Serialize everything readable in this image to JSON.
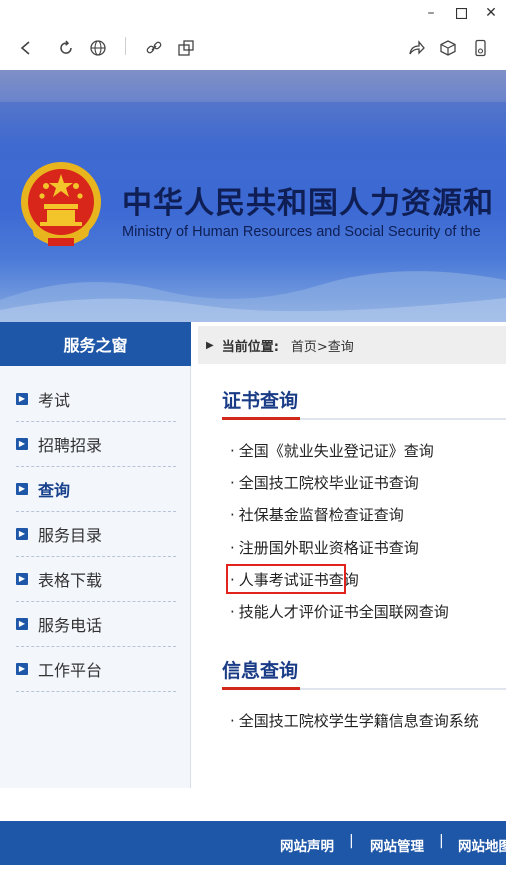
{
  "window": {
    "minimize_label": "–",
    "maximize_label": "☐",
    "close_label": "✕"
  },
  "toolbar": {
    "icons": [
      "back-icon",
      "refresh-icon",
      "globe-icon",
      "link-icon",
      "screenshot-icon",
      "share-icon",
      "cube-icon",
      "phone-icon"
    ]
  },
  "banner": {
    "title": "中华人民共和国人力资源和",
    "subtitle": "Ministry of Human Resources and Social Security of the"
  },
  "sidebar": {
    "heading": "服务之窗",
    "items": [
      {
        "label": "考试"
      },
      {
        "label": "招聘招录"
      },
      {
        "label": "查询"
      },
      {
        "label": "服务目录"
      },
      {
        "label": "表格下载"
      },
      {
        "label": "服务电话"
      },
      {
        "label": "工作平台"
      }
    ]
  },
  "breadcrumb": {
    "label": "当前位置:",
    "path": "首页>查询"
  },
  "certificate_section": {
    "title": "证书查询",
    "links": [
      "全国《就业失业登记证》查询",
      "全国技工院校毕业证书查询",
      "社保基金监督检查证查询",
      "注册国外职业资格证书查询",
      "人事考试证书查询",
      "技能人才评价证书全国联网查询"
    ]
  },
  "info_section": {
    "title": "信息查询",
    "links": [
      "全国技工院校学生学籍信息查询系统"
    ]
  },
  "footer": {
    "links": [
      "网站声明",
      "网站管理",
      "网站地图"
    ],
    "separator": "|"
  },
  "colors": {
    "brand": "#1f57a8",
    "accent_red": "#d0291b",
    "highlight": "#e0231d"
  }
}
